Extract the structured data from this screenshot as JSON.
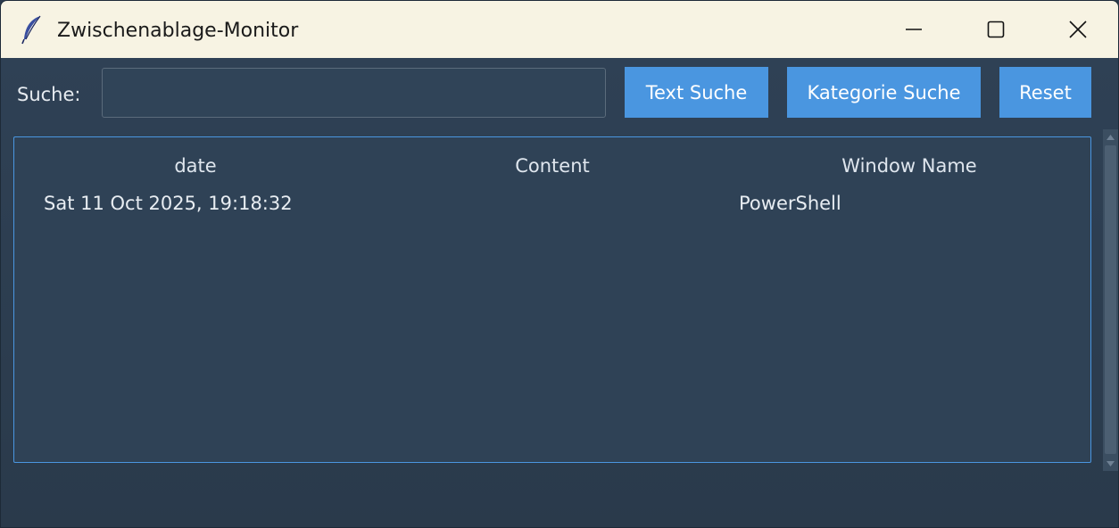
{
  "window": {
    "title": "Zwischenablage-Monitor",
    "icon": "feather-icon"
  },
  "search": {
    "label": "Suche:",
    "value": "",
    "placeholder": ""
  },
  "buttons": {
    "text_search": "Text Suche",
    "category_search": "Kategorie Suche",
    "reset": "Reset"
  },
  "table": {
    "columns": [
      "date",
      "Content",
      "Window Name"
    ],
    "rows": [
      {
        "date": "Sat 11 Oct 2025, 19:18:32",
        "content": "",
        "window_name": "PowerShell"
      }
    ]
  },
  "colors": {
    "accent": "#4a96e0",
    "background": "#2c3e50",
    "titlebar": "#f7f3e3"
  }
}
